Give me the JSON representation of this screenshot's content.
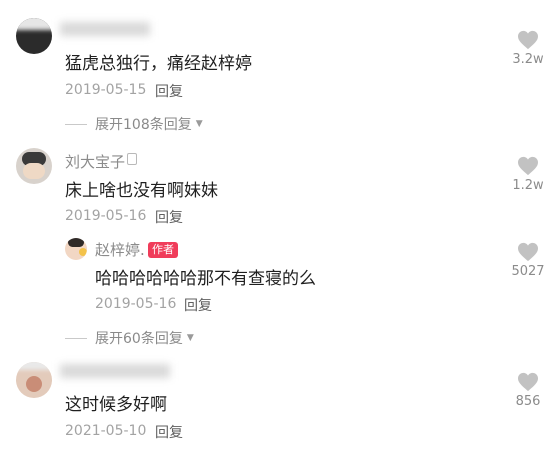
{
  "comments": [
    {
      "name": "",
      "text": "猛虎总独行，痛经赵梓婷",
      "date": "2019-05-15",
      "reply": "回复",
      "likes": "3.2w",
      "expand": "展开108条回复"
    },
    {
      "name": "刘大宝子",
      "text": "床上啥也没有啊妹妹",
      "date": "2019-05-16",
      "reply": "回复",
      "likes": "1.2w",
      "sub_reply": {
        "name": "赵梓婷.",
        "badge": "作者",
        "text": "哈哈哈哈哈哈那不有查寝的么",
        "date": "2019-05-16",
        "reply": "回复",
        "likes": "5027"
      },
      "expand": "展开60条回复"
    },
    {
      "name": "",
      "text": "这时候多好啊",
      "date": "2021-05-10",
      "reply": "回复",
      "likes": "856"
    }
  ]
}
